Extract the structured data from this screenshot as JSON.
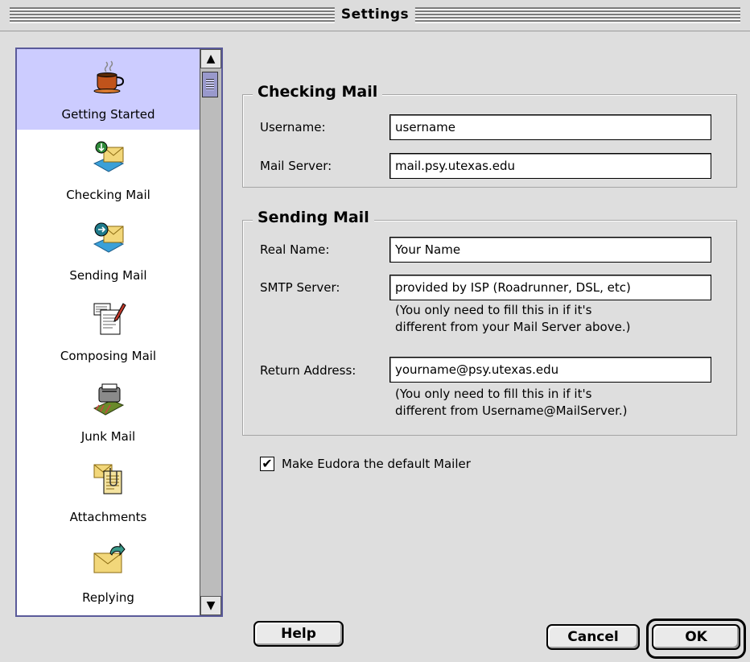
{
  "window": {
    "title": "Settings"
  },
  "sidebar": {
    "items": [
      {
        "label": "Getting Started",
        "icon": "coffee-cup-icon",
        "selected": true
      },
      {
        "label": "Checking Mail",
        "icon": "checking-mail-icon",
        "selected": false
      },
      {
        "label": "Sending Mail",
        "icon": "sending-mail-icon",
        "selected": false
      },
      {
        "label": "Composing Mail",
        "icon": "composing-mail-icon",
        "selected": false
      },
      {
        "label": "Junk Mail",
        "icon": "junk-mail-icon",
        "selected": false
      },
      {
        "label": "Attachments",
        "icon": "attachments-icon",
        "selected": false
      },
      {
        "label": "Replying",
        "icon": "replying-icon",
        "selected": false
      }
    ]
  },
  "checking": {
    "title": "Checking Mail",
    "username_label": "Username:",
    "username_value": "username",
    "server_label": "Mail Server:",
    "server_value": "mail.psy.utexas.edu"
  },
  "sending": {
    "title": "Sending Mail",
    "realname_label": "Real Name:",
    "realname_value": "Your Name",
    "smtp_label": "SMTP Server:",
    "smtp_value": "provided by ISP (Roadrunner, DSL, etc)",
    "smtp_note_1": "(You only need to fill this in if it's",
    "smtp_note_2": "different from your Mail Server above.)",
    "return_label": "Return Address:",
    "return_value": "yourname@psy.utexas.edu",
    "return_note_1": "(You only need to fill this in if it's",
    "return_note_2": "different from Username@MailServer.)"
  },
  "default_mailer": {
    "label": "Make Eudora the default Mailer",
    "checked": true
  },
  "buttons": {
    "help": "Help",
    "cancel": "Cancel",
    "ok": "OK"
  },
  "colors": {
    "selection": "#ccccff",
    "background": "#dedede",
    "scroll_thumb": "#9999cc"
  }
}
